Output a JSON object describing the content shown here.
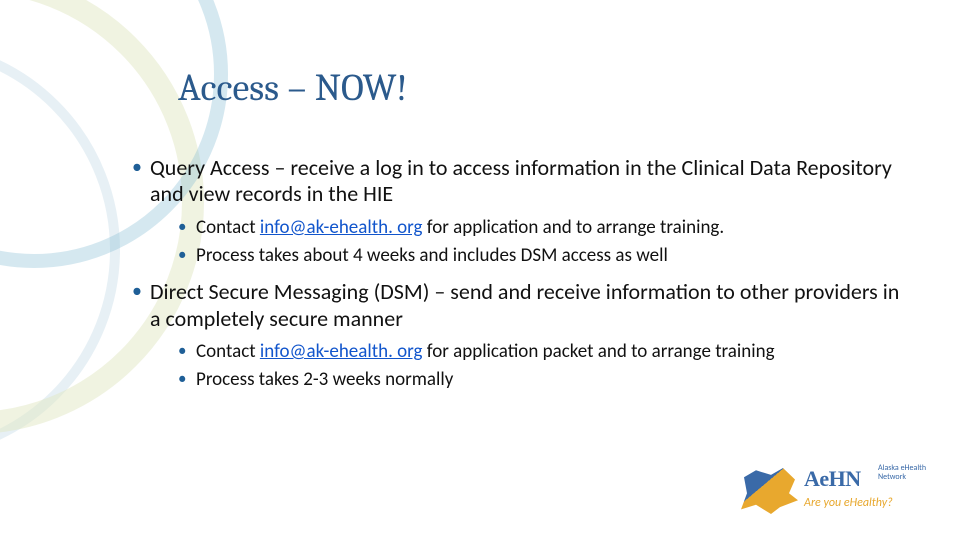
{
  "title": "Access – NOW!",
  "bullets": [
    {
      "text": "Query Access – receive a log in to access information in the Clinical Data Repository and view records in the HIE",
      "sub": [
        {
          "pre": "Contact ",
          "link": "info@ak-ehealth. org",
          "post": " for application and to arrange training."
        },
        {
          "pre": "Process takes about 4 weeks and includes DSM access as well",
          "link": "",
          "post": ""
        }
      ]
    },
    {
      "text": "Direct Secure Messaging (DSM) – send and receive information to other providers in a completely secure manner",
      "sub": [
        {
          "pre": "Contact ",
          "link": "info@ak-ehealth. org",
          "post": " for application packet and to arrange training"
        },
        {
          "pre": "Process takes 2-3 weeks normally",
          "link": "",
          "post": ""
        }
      ]
    }
  ],
  "logo": {
    "name": "AeHN",
    "sub": "Alaska\neHealth\nNetwork",
    "tag": "Are you eHealthy?"
  }
}
